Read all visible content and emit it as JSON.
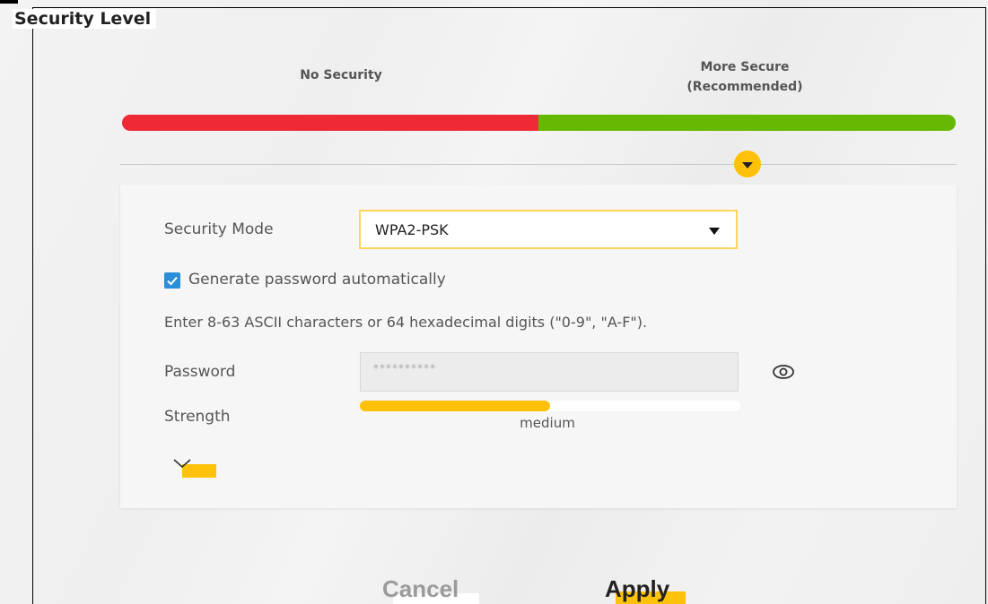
{
  "section": {
    "title": "Security Level"
  },
  "levels": {
    "left_label": "No Security",
    "right_label_line1": "More Secure",
    "right_label_line2": "(Recommended)",
    "left_color": "#ee2a37",
    "right_color": "#66b800",
    "selected_marker_color": "#ffc107",
    "selected_level": "More Secure"
  },
  "form": {
    "security_mode_label": "Security Mode",
    "security_mode_value": "WPA2-PSK",
    "generate_checkbox_label": "Generate password automatically",
    "generate_checked": true,
    "hint": "Enter 8-63 ASCII characters or 64 hexadecimal digits (\"0-9\", \"A-F\").",
    "password_label": "Password",
    "password_value": "**********",
    "strength_label": "Strength",
    "strength_text": "medium",
    "strength_fraction": 0.5,
    "strength_color": "#ffc107"
  },
  "icons": {
    "eye": "eye-icon",
    "chevron": "chevron-down-icon",
    "dropdown_caret": "caret-down-icon",
    "check": "check-icon"
  },
  "actions": {
    "cancel_label": "Cancel",
    "apply_label": "Apply",
    "accent": "#ffc20a"
  }
}
